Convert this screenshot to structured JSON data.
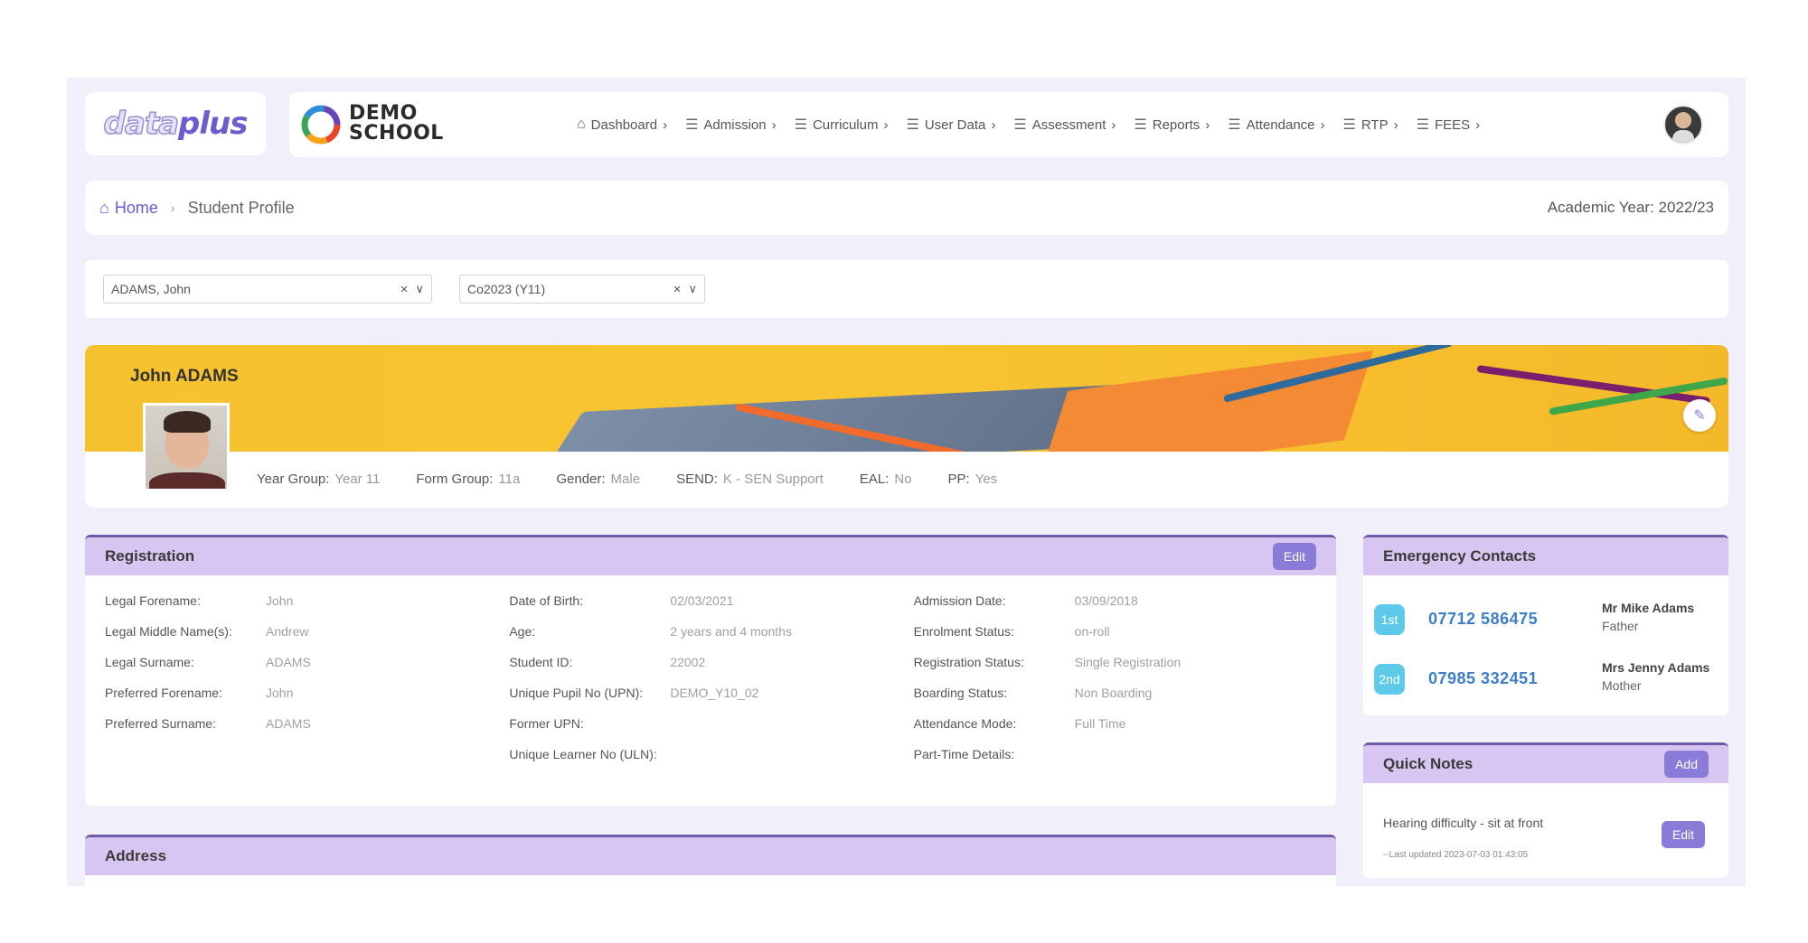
{
  "logo": {
    "part1": "data",
    "part2": "plus"
  },
  "school": {
    "line1": "DEMO",
    "line2": "SCHOOL"
  },
  "nav": [
    {
      "label": "Dashboard",
      "icon": "home-icon"
    },
    {
      "label": "Admission",
      "icon": "menu-icon"
    },
    {
      "label": "Curriculum",
      "icon": "menu-icon"
    },
    {
      "label": "User Data",
      "icon": "menu-icon"
    },
    {
      "label": "Assessment",
      "icon": "menu-icon"
    },
    {
      "label": "Reports",
      "icon": "menu-icon"
    },
    {
      "label": "Attendance",
      "icon": "menu-icon"
    },
    {
      "label": "RTP",
      "icon": "menu-icon"
    },
    {
      "label": "FEES",
      "icon": "menu-icon"
    }
  ],
  "breadcrumb": {
    "home": "Home",
    "current": "Student Profile"
  },
  "academic_year": "Academic Year: 2022/23",
  "selectors": {
    "student": "ADAMS, John",
    "cohort": "Co2023 (Y11)"
  },
  "profile": {
    "name": "John ADAMS",
    "meta": [
      {
        "label": "Year Group:",
        "value": "Year 11"
      },
      {
        "label": "Form Group:",
        "value": "11a"
      },
      {
        "label": "Gender:",
        "value": "Male"
      },
      {
        "label": "SEND:",
        "value": "K - SEN Support"
      },
      {
        "label": "EAL:",
        "value": "No"
      },
      {
        "label": "PP:",
        "value": "Yes"
      }
    ]
  },
  "registration": {
    "title": "Registration",
    "edit_label": "Edit",
    "col1": [
      {
        "k": "Legal Forename:",
        "v": "John"
      },
      {
        "k": "Legal Middle Name(s):",
        "v": "Andrew"
      },
      {
        "k": "Legal Surname:",
        "v": "ADAMS"
      },
      {
        "k": "Preferred Forename:",
        "v": "John"
      },
      {
        "k": "Preferred Surname:",
        "v": "ADAMS"
      }
    ],
    "col2": [
      {
        "k": "Date of Birth:",
        "v": "02/03/2021"
      },
      {
        "k": "Age:",
        "v": "2 years and 4 months"
      },
      {
        "k": "Student ID:",
        "v": "22002"
      },
      {
        "k": "Unique Pupil No (UPN):",
        "v": "DEMO_Y10_02"
      },
      {
        "k": "Former UPN:",
        "v": ""
      },
      {
        "k": "Unique Learner No (ULN):",
        "v": ""
      }
    ],
    "col3": [
      {
        "k": "Admission Date:",
        "v": "03/09/2018"
      },
      {
        "k": "Enrolment Status:",
        "v": "on-roll"
      },
      {
        "k": "Registration Status:",
        "v": "Single Registration"
      },
      {
        "k": "Boarding Status:",
        "v": "Non Boarding"
      },
      {
        "k": "Attendance Mode:",
        "v": "Full Time"
      },
      {
        "k": "Part-Time Details:",
        "v": ""
      }
    ]
  },
  "address": {
    "title": "Address"
  },
  "emergency": {
    "title": "Emergency Contacts",
    "contacts": [
      {
        "badge": "1st",
        "phone": "07712 586475",
        "name": "Mr Mike Adams",
        "relation": "Father"
      },
      {
        "badge": "2nd",
        "phone": "07985 332451",
        "name": "Mrs Jenny Adams",
        "relation": "Mother"
      }
    ]
  },
  "quick_notes": {
    "title": "Quick Notes",
    "add_label": "Add",
    "note": "Hearing difficulty - sit at front",
    "updated": "--Last updated 2023-07-03 01:43:05",
    "edit_label": "Edit"
  },
  "colors": {
    "accent": "#8b7bd8",
    "panel_header": "#d8c6f2",
    "banner": "#f6c12e",
    "phone": "#3d7ec5",
    "badge": "#5ec9e8"
  }
}
